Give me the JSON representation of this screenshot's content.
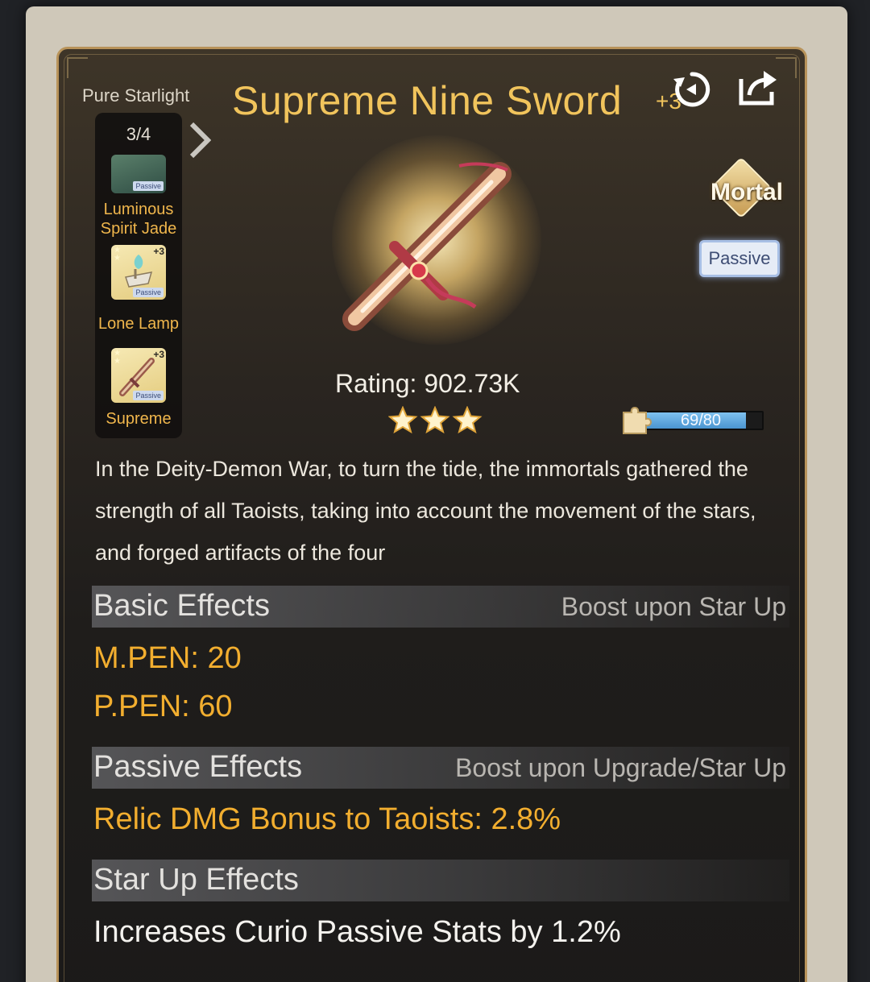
{
  "header": {
    "set_name": "Pure Starlight",
    "title": "Supreme Nine Sword",
    "title_plus": "+3"
  },
  "set_panel": {
    "count": "3/4",
    "items": [
      {
        "label": "Luminous Spirit Jade",
        "tag": "Passive"
      },
      {
        "label": "Lone Lamp",
        "tag": "Passive",
        "level": "+3"
      },
      {
        "label": "Supreme",
        "tag": "Passive",
        "level": "+3"
      }
    ]
  },
  "badges": {
    "grade": "Mortal",
    "type": "Passive"
  },
  "rating": {
    "text": "Rating: 902.73K",
    "stars": 3
  },
  "shards": {
    "text": "69/80",
    "current": 69,
    "max": 80
  },
  "description": "In the Deity-Demon War, to turn the tide, the immortals gathered the strength of all Taoists, taking into account the movement of the stars, and forged artifacts of the four",
  "sections": {
    "basic": {
      "title": "Basic Effects",
      "note": "Boost upon Star Up",
      "stats": [
        "M.PEN: 20",
        "P.PEN: 60"
      ]
    },
    "passive": {
      "title": "Passive Effects",
      "note": "Boost upon Upgrade/Star Up",
      "stats": [
        "Relic DMG Bonus to Taoists: 2.8%"
      ]
    },
    "star_up": {
      "title": "Star Up Effects",
      "stats": [
        "Increases Curio Passive Stats by 1.2%"
      ]
    }
  },
  "icons": {
    "reset": "reset-icon",
    "share": "share-icon",
    "arrow": "chevron-right-icon",
    "star": "star-icon",
    "puzzle": "puzzle-piece-icon"
  },
  "colors": {
    "title": "#f1c45c",
    "stat": "#f2ae2f",
    "progress": "#5aa6dd",
    "frame": "#b8935a"
  }
}
